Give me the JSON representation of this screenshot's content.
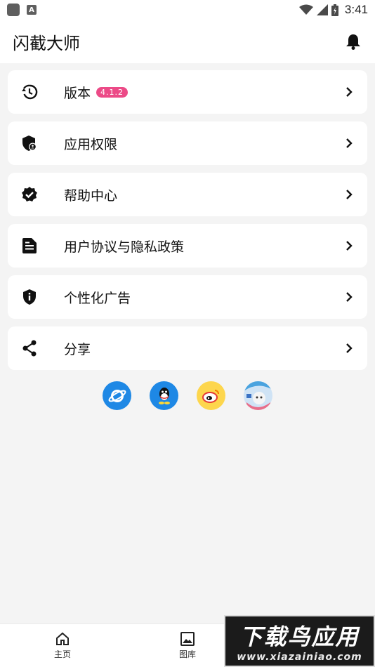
{
  "status_bar": {
    "time": "3:41",
    "a_icon_label": "A"
  },
  "header": {
    "title": "闪截大师"
  },
  "menu": [
    {
      "label": "版本",
      "badge": "4.1.2",
      "icon": "history-icon"
    },
    {
      "label": "应用权限",
      "icon": "shield-user-icon"
    },
    {
      "label": "帮助中心",
      "icon": "verified-badge-icon"
    },
    {
      "label": "用户协议与隐私政策",
      "icon": "document-icon"
    },
    {
      "label": "个性化广告",
      "icon": "shield-info-icon"
    },
    {
      "label": "分享",
      "icon": "share-icon"
    }
  ],
  "share": [
    "browser-icon",
    "qq-icon",
    "weibo-icon",
    "avatar-icon"
  ],
  "bottom_nav": [
    {
      "label": "主页",
      "icon": "home-icon"
    },
    {
      "label": "图库",
      "icon": "image-icon"
    }
  ],
  "watermark": {
    "main": "下载鸟应用",
    "sub": "www.xiazainiao.com"
  },
  "colors": {
    "badge": "#ec4a87",
    "share_blue": "#1e88e5",
    "weibo_yellow": "#fdd64d"
  }
}
